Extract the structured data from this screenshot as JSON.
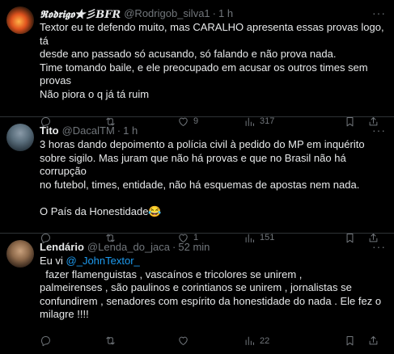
{
  "tweets": [
    {
      "name": "𝕽𝖔𝖉𝖗𝖎𝖌𝖔★彡BFR",
      "handle": "@Rodrigob_silva1",
      "time": "1 h",
      "lines": [
        "Textor eu te defendo muito, mas CARALHO apresenta essas provas logo, tá",
        "desde ano passado só acusando, só falando e não prova nada.",
        "Time tomando baile, e ele preocupado em acusar os outros times sem",
        "provas",
        "Não piora o q já tá ruim"
      ],
      "replies": "",
      "retweets": "",
      "likes": "9",
      "views": "317"
    },
    {
      "name": "Tito",
      "handle": "@DacalTM",
      "time": "1 h",
      "lines": [
        "3 horas dando depoimento a polícia civil à pedido do MP em inquérito",
        "sobre sigilo. Mas juram que não há provas e que no Brasil não há corrupção",
        "no futebol, times, entidade, não há esquemas de apostas nem nada.",
        "",
        "O País da Honestidade😂"
      ],
      "replies": "",
      "retweets": "",
      "likes": "1",
      "views": "151"
    },
    {
      "name": "Lendário",
      "handle": "@Lenda_do_jaca",
      "time": "52 min",
      "line1_before": "Eu vi ",
      "mention": "@_JohnTextor_",
      "line1_after": "  fazer flamenguistas , vascaínos e tricolores se unirem ,",
      "lines": [
        "palmeirenses , são paulinos e corintianos se unirem , jornalistas se",
        "confundirem , senadores com espírito da honestidade do nada . Ele fez o",
        "milagre !!!!"
      ],
      "replies": "",
      "retweets": "",
      "likes": "",
      "views": "22"
    }
  ],
  "icons": {
    "more": "more-icon",
    "reply": "reply-icon",
    "retweet": "retweet-icon",
    "like": "like-icon",
    "views": "views-icon",
    "bookmark": "bookmark-icon",
    "share": "share-icon"
  },
  "colors": {
    "background": "#000000",
    "text": "#e7e9ea",
    "muted": "#71767b",
    "mention": "#1d9bf0",
    "divider": "#2f3336"
  }
}
